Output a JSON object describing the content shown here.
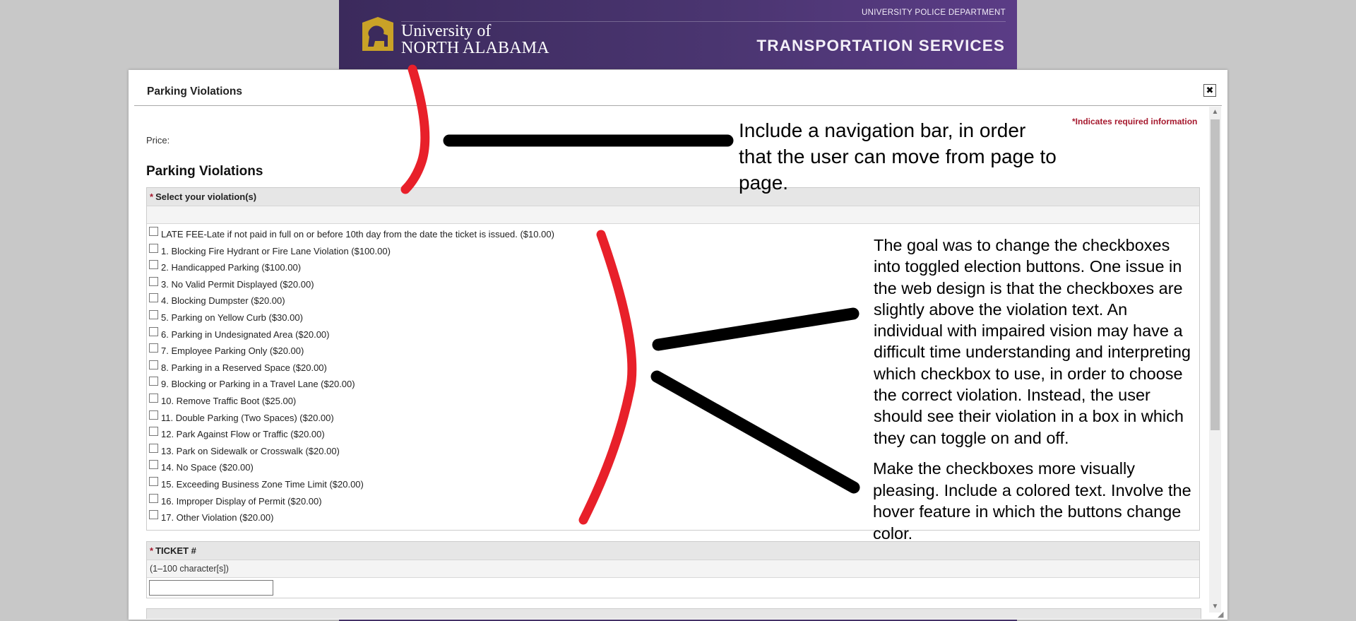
{
  "banner": {
    "univ_of": "University of",
    "univ_name": "NORTH ALABAMA",
    "dept": "UNIVERSITY POLICE DEPARTMENT",
    "service": "TRANSPORTATION SERVICES",
    "colors": {
      "purple": "#4a3570",
      "gold": "#c9a227"
    }
  },
  "modal": {
    "title": "Parking Violations",
    "close_glyph": "✖",
    "required_note": "*Indicates required information",
    "price_label": "Price:",
    "section_heading": "Parking Violations",
    "violations_group": {
      "label": "Select your violation(s)",
      "required_mark": "*",
      "items": [
        "LATE FEE-Late if not paid in full on or before 10th day from the date the ticket is issued. ($10.00)",
        "1. Blocking Fire Hydrant or Fire Lane Violation ($100.00)",
        "2. Handicapped Parking ($100.00)",
        "3. No Valid Permit Displayed ($20.00)",
        "4. Blocking Dumpster ($20.00)",
        "5. Parking on Yellow Curb ($30.00)",
        "6. Parking in Undesignated Area ($20.00)",
        "7. Employee Parking Only ($20.00)",
        "8. Parking in a Reserved Space ($20.00)",
        "9. Blocking or Parking in a Travel Lane ($20.00)",
        "10. Remove Traffic Boot ($25.00)",
        "11. Double Parking (Two Spaces) ($20.00)",
        "12. Park Against Flow or Traffic ($20.00)",
        "13. Park on Sidewalk or Crosswalk ($20.00)",
        "14. No Space ($20.00)",
        "15. Exceeding Business Zone Time Limit ($20.00)",
        "16. Improper Display of Permit ($20.00)",
        "17. Other Violation ($20.00)"
      ]
    },
    "ticket_group": {
      "label": "TICKET #",
      "required_mark": "*",
      "hint": "(1–100 character[s])",
      "value": ""
    }
  },
  "annotations": {
    "nav": "Include a navigation bar, in order that the user can move from page to page.",
    "toggle": "The goal was to change the checkboxes into toggled election buttons. One issue in the web design is that the checkboxes are slightly above the violation text. An individual with impaired vision may have a difficult time understanding and interpreting which checkbox to use, in order to choose the correct violation. Instead, the user should see their violation in a box in which they can toggle on and off.",
    "style": "Make the checkboxes more visually pleasing. Include a colored text. Involve the hover feature in which the buttons change color.",
    "colors": {
      "red_mark": "#e8202a",
      "black_mark": "#000000"
    }
  }
}
